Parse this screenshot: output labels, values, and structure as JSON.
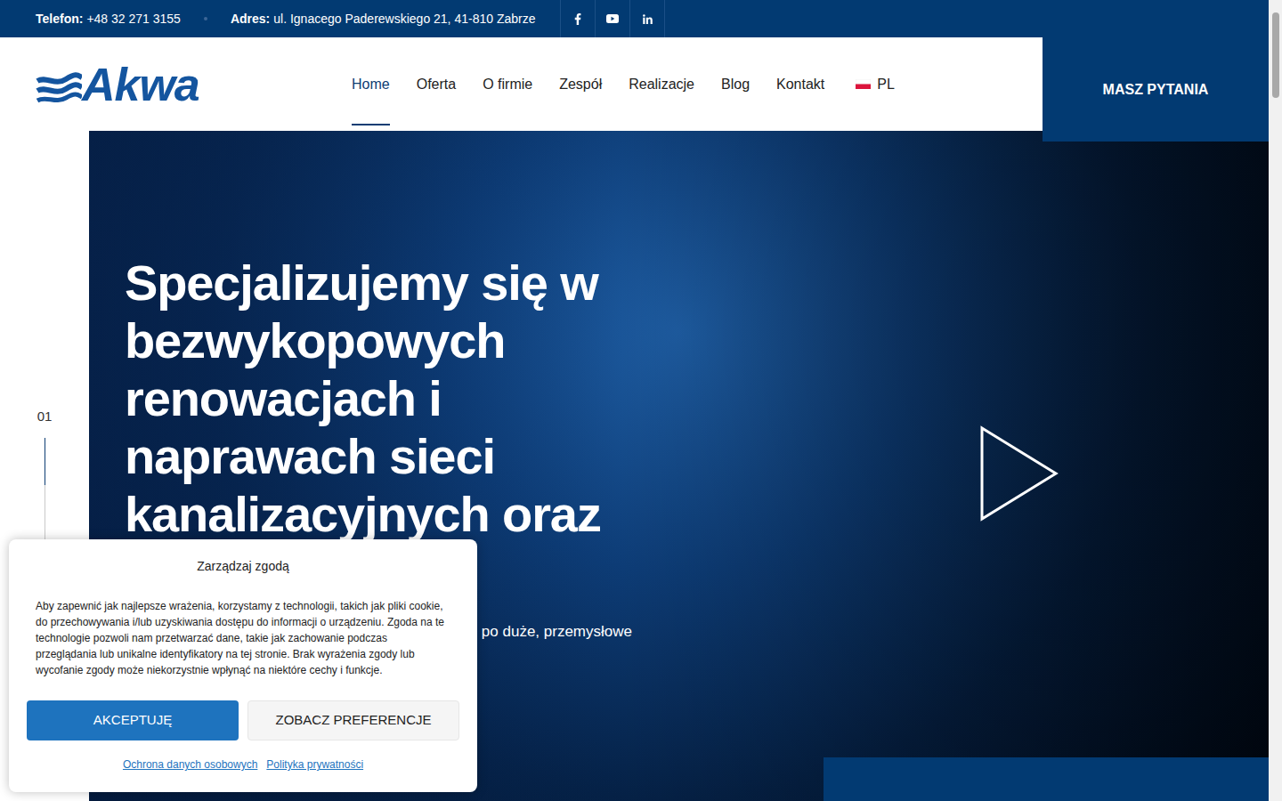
{
  "topbar": {
    "phone_label": "Telefon:",
    "phone": "+48 32 271 3155",
    "address_label": "Adres:",
    "address": "ul. Ignacego Paderewskiego 21, 41-810 Zabrze"
  },
  "header": {
    "logo": "Akwa",
    "nav": [
      {
        "label": "Home",
        "selected": true
      },
      {
        "label": "Oferta",
        "selected": false
      },
      {
        "label": "O firmie",
        "selected": false
      },
      {
        "label": "Zespół",
        "selected": false
      },
      {
        "label": "Realizacje",
        "selected": false
      },
      {
        "label": "Blog",
        "selected": false
      },
      {
        "label": "Kontakt",
        "selected": false
      }
    ],
    "language": "PL",
    "cta": "MASZ PYTANIA"
  },
  "slider": {
    "index": "01",
    "level": 0.25
  },
  "hero": {
    "heading": "Specjalizujemy się w bezwykopowych renowacjach i naprawach sieci kanalizacyjnych oraz",
    "subtitle": "po duże, przemysłowe"
  },
  "cookie": {
    "title": "Zarządzaj zgodą",
    "text": "Aby zapewnić jak najlepsze wrażenia, korzystamy z technologii, takich jak pliki cookie, do przechowywania i/lub uzyskiwania dostępu do informacji o urządzeniu. Zgoda na te technologie pozwoli nam przetwarzać dane, takie jak zachowanie podczas przeglądania lub unikalne identyfikatory na tej stronie. Brak wyrażenia zgody lub wycofanie zgody może niekorzystnie wpłynąć na niektóre cechy i funkcje.",
    "buttons": [
      {
        "label": "AKCEPTUJĘ",
        "kind": "primary"
      },
      {
        "label": "ZOBACZ PREFERENCJE",
        "kind": "secondary"
      }
    ],
    "links": [
      "Ochrona danych osobowych",
      "Polityka prywatności"
    ]
  }
}
